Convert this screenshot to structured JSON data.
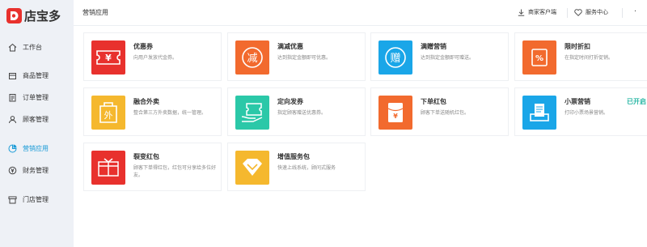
{
  "app": {
    "logo_text": "店宝多"
  },
  "sidebar": {
    "items": [
      {
        "label": "工作台",
        "icon": "home-icon"
      },
      {
        "label": "商品管理",
        "icon": "product-icon"
      },
      {
        "label": "订单管理",
        "icon": "order-icon"
      },
      {
        "label": "顾客管理",
        "icon": "customer-icon"
      },
      {
        "label": "营销应用",
        "icon": "marketing-icon",
        "active": true
      },
      {
        "label": "财务管理",
        "icon": "finance-icon"
      },
      {
        "label": "门店管理",
        "icon": "store-icon"
      }
    ]
  },
  "header": {
    "title": "营销应用",
    "client_label": "商家客户端",
    "service_label": "服务中心",
    "user_label": "."
  },
  "apps": [
    {
      "title": "优惠券",
      "desc": "向用户发放代金券。",
      "glyph": "¥",
      "icon": "coupon-icon",
      "color": "#e8312d"
    },
    {
      "title": "满减优惠",
      "desc": "达到指定金额即可优惠。",
      "glyph": "减",
      "icon": "discount-icon",
      "color": "#f26a2e"
    },
    {
      "title": "满赠营销",
      "desc": "达到指定金额即可赠送。",
      "glyph": "赠",
      "icon": "gift-icon",
      "color": "#1aa6e8"
    },
    {
      "title": "限时折扣",
      "desc": "在指定时间打折促销。",
      "glyph": "%",
      "icon": "timed-discount-icon",
      "color": "#f26a2e"
    },
    {
      "title": "融合外卖",
      "desc": "整合第三方外卖数据，统一管理。",
      "glyph": "外",
      "icon": "takeout-icon",
      "color": "#f5b82e"
    },
    {
      "title": "定向发券",
      "desc": "指定顾客赠送优惠券。",
      "glyph": "",
      "icon": "targeted-coupon-icon",
      "color": "#2bc8a8"
    },
    {
      "title": "下单红包",
      "desc": "顾客下单送随机红包。",
      "glyph": "¥",
      "icon": "red-packet-icon",
      "color": "#f26a2e"
    },
    {
      "title": "小票营销",
      "desc": "打印小票场景营销。",
      "glyph": "",
      "icon": "receipt-icon",
      "color": "#1aa6e8",
      "badge": "已开启"
    },
    {
      "title": "裂变红包",
      "desc": "顾客下单得红包，红包可分享给多位好友。",
      "glyph": "",
      "icon": "fission-red-packet-icon",
      "color": "#e8312d"
    },
    {
      "title": "增值服务包",
      "desc": "快速上线系统，顾问式服务",
      "glyph": "",
      "icon": "service-package-icon",
      "color": "#f5b82e"
    }
  ],
  "colors": {
    "accent": "#1a9bd7",
    "badge": "#2bb7a5",
    "sidebar_bg": "#eef1f6"
  }
}
